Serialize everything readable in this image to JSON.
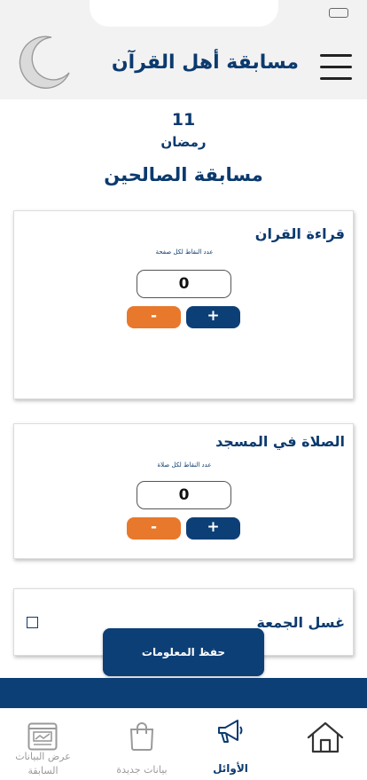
{
  "app": {
    "title": "مسابقة أهل القرآن"
  },
  "date": {
    "day": "11",
    "month": "رمضان"
  },
  "contest_title": "مسابقة الصالحين",
  "cards": [
    {
      "title": "قراءة القران",
      "subtitle": "عدد النقاط لكل صفحة",
      "value": "0",
      "minus_label": "-",
      "plus_label": "+"
    },
    {
      "title": "الصلاة في المسجد",
      "subtitle": "عدد النقاط لكل صلاة",
      "value": "0",
      "minus_label": "-",
      "plus_label": "+"
    }
  ],
  "checkbox_card": {
    "title": "غسل الجمعة",
    "checked": false
  },
  "save_button_label": "حفظ المعلومات",
  "bottom_nav": {
    "items": [
      {
        "label": "عرض البيانات السابقة",
        "icon": "chart-report-icon",
        "active": false
      },
      {
        "label": "بيانات جديدة",
        "icon": "shopping-bag-icon",
        "active": false
      },
      {
        "label": "الأوائل",
        "icon": "megaphone-icon",
        "active": true
      },
      {
        "label": "",
        "icon": "home-icon",
        "active": false
      }
    ]
  },
  "colors": {
    "primary": "#0d3f77",
    "accent": "#e8782c",
    "topbar_bg": "#f2f2f2",
    "nav_inactive": "#9a9a9a"
  }
}
